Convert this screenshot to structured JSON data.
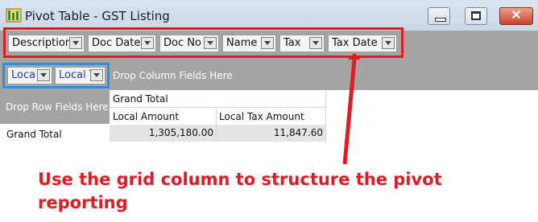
{
  "window": {
    "title": "Pivot Table - GST Listing",
    "close_glyph": "✕"
  },
  "filter_fields": [
    {
      "label": "Description"
    },
    {
      "label": "Doc Date"
    },
    {
      "label": "Doc No"
    },
    {
      "label": "Name"
    },
    {
      "label": "Tax"
    },
    {
      "label": "Tax Date"
    }
  ],
  "data_fields": [
    {
      "label": "Loca"
    },
    {
      "label": "Local T"
    }
  ],
  "drop_zones": {
    "column": "Drop Column Fields Here",
    "row": "Drop Row Fields Here"
  },
  "grid": {
    "column_header": "Grand Total",
    "measures": [
      "Local Amount",
      "Local Tax Amount"
    ],
    "row_label": "Grand Total",
    "values": [
      "1,305,180.00",
      "11,847.60"
    ]
  },
  "annotation": {
    "text": "Use the grid column to structure the pivot reporting",
    "color": "#e01b22"
  },
  "colors": {
    "filter_highlight": "#e01b22",
    "data_field_highlight": "#2e8fe0",
    "zone_gray": "#a4a4a4"
  }
}
